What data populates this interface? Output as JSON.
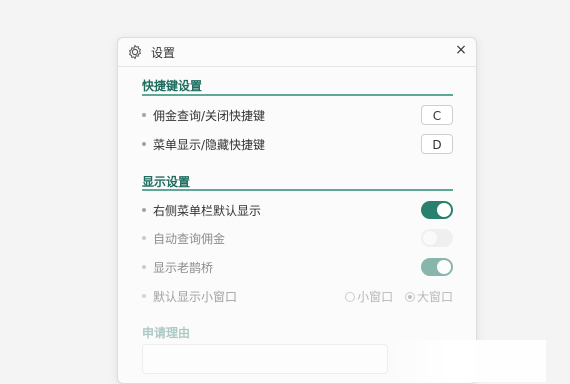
{
  "dialog": {
    "title": "设置",
    "close_symbol": "×"
  },
  "sections": {
    "shortcuts": {
      "title": "快捷键设置",
      "items": [
        {
          "label": "佣金查询/关闭快捷键",
          "key": "C"
        },
        {
          "label": "菜单显示/隐藏快捷键",
          "key": "D"
        }
      ]
    },
    "display": {
      "title": "显示设置",
      "items": [
        {
          "label": "右侧菜单栏默认显示",
          "toggle": "on"
        },
        {
          "label": "自动查询佣金",
          "toggle": "off"
        },
        {
          "label": "显示老鹊桥",
          "toggle": "on"
        },
        {
          "label": "默认显示小窗口"
        }
      ],
      "window_options": [
        "小窗口",
        "大窗口"
      ],
      "window_selected": "大窗口"
    },
    "apply": {
      "title": "申请理由"
    }
  },
  "colors": {
    "accent": "#2b7f6f",
    "section_text": "#1f6d5f"
  }
}
